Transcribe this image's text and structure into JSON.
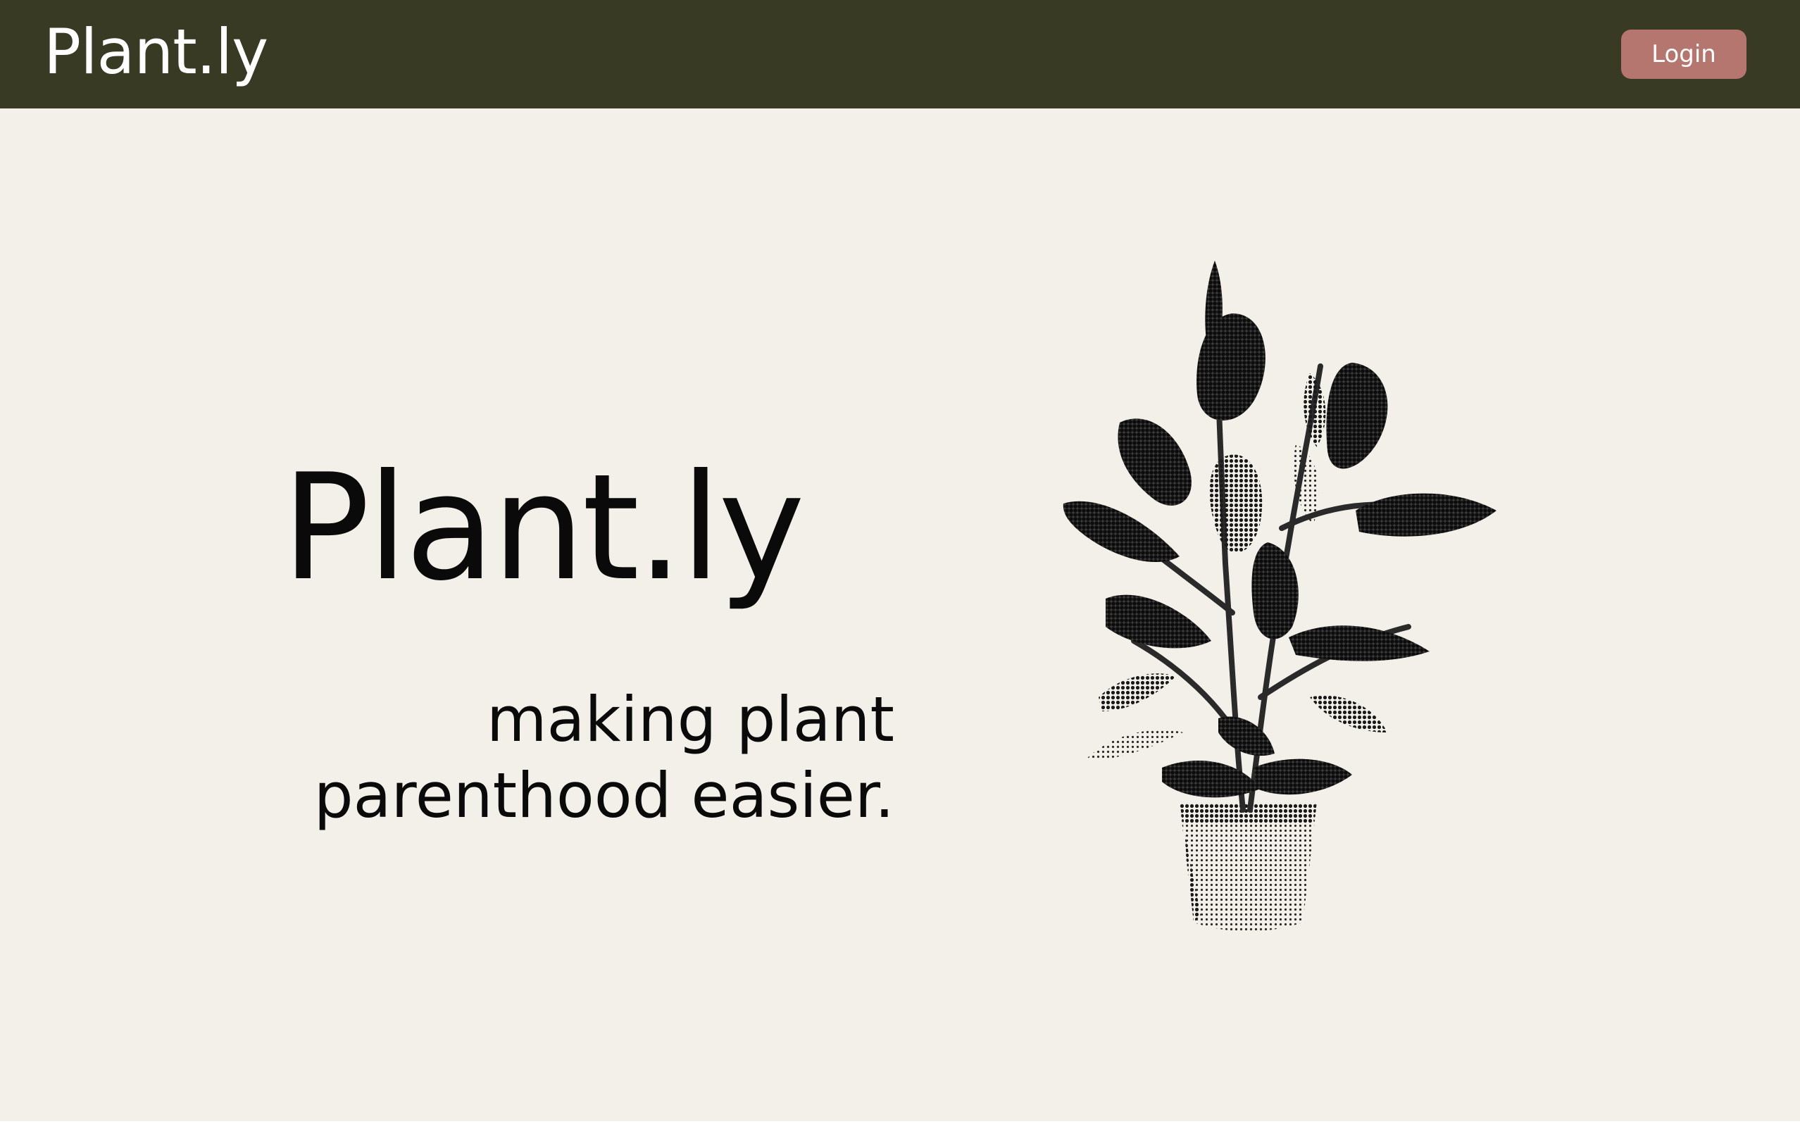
{
  "navbar": {
    "logo_text": "Plant.ly",
    "login_label": "Login"
  },
  "hero": {
    "title": "Plant.ly",
    "tagline_line1": "making plant",
    "tagline_line2": "parenthood easier."
  },
  "colors": {
    "navbar_bg": "#383a24",
    "page_bg": "#f3f0e9",
    "login_button_bg": "#b4766e",
    "text": "#0a0a0a"
  },
  "icons": {
    "hero_image": "potted-rubber-plant-halftone"
  }
}
